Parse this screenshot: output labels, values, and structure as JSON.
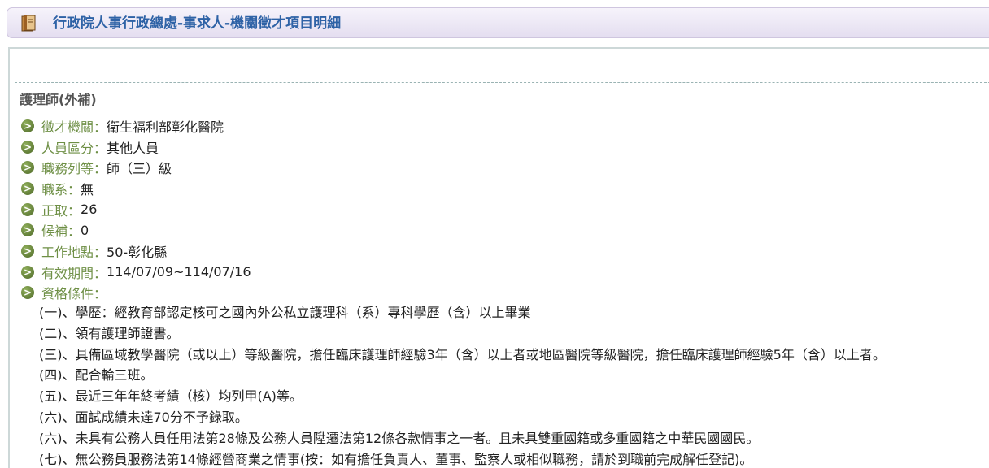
{
  "header": {
    "title": "行政院人事行政總處-事求人-機關徵才項目明細",
    "icon": "book-icon"
  },
  "job": {
    "title": "護理師(外補)"
  },
  "fields": [
    {
      "label": "徵才機關",
      "sep": "：",
      "value": "衛生福利部彰化醫院"
    },
    {
      "label": "人員區分",
      "sep": "：",
      "value": "其他人員"
    },
    {
      "label": "職務列等",
      "sep": "：",
      "value": "師（三）級"
    },
    {
      "label": "職系",
      "sep": "：",
      "value": "無"
    },
    {
      "label": "正取",
      "sep": "：",
      "value": "26"
    },
    {
      "label": "候補",
      "sep": "：",
      "value": "0"
    },
    {
      "label": "工作地點",
      "sep": "：",
      "value": "50-彰化縣"
    },
    {
      "label": "有效期間",
      "sep": "：",
      "value": "114/07/09~114/07/16"
    },
    {
      "label": "資格條件",
      "sep": "：",
      "value": ""
    }
  ],
  "bullet_glyph": ">",
  "qualifications": [
    "(一)、學歷：經教育部認定核可之國內外公私立護理科（系）專科學歷（含）以上畢業",
    "(二)、領有護理師證書。",
    "(三)、具備區域教學醫院（或以上）等級醫院，擔任臨床護理師經驗3年（含）以上者或地區醫院等級醫院，擔任臨床護理師經驗5年（含）以上者。",
    "(四)、配合輪三班。",
    "(五)、最近三年年終考績（核）均列甲(A)等。",
    "(六)、面試成績未達70分不予錄取。",
    "(六)、未具有公務人員任用法第28條及公務人員陞遷法第12條各款情事之一者。且未具雙重國籍或多重國籍之中華民國國民。",
    "(七)、無公務員服務法第14條經營商業之情事(按：如有擔任負責人、董事、監察人或相似職務，請於到職前完成解任登記)。"
  ],
  "colors": {
    "title_blue": "#2e62a6",
    "label_green": "#6e8f45",
    "bullet_green": "#5f7f35",
    "header_bg": "#e9e4f2"
  }
}
